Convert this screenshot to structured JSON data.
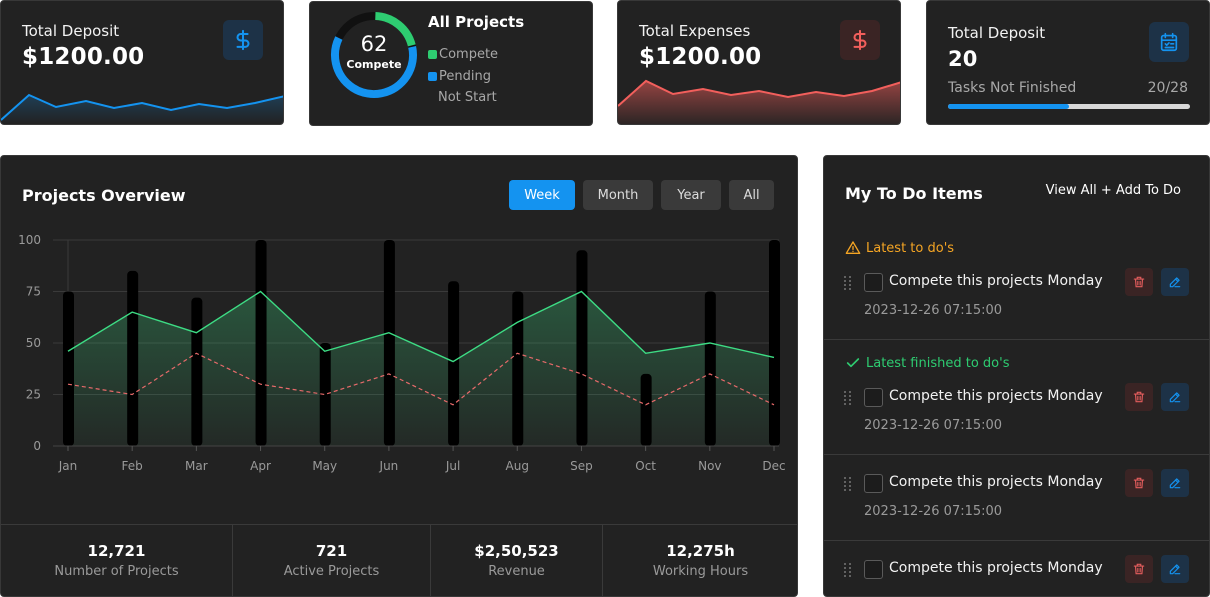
{
  "cards": {
    "deposit": {
      "title": "Total Deposit",
      "value": "$1200.00",
      "icon": "dollar-icon",
      "color": "#1493f0"
    },
    "projects": {
      "title": "All Projects",
      "count": "62",
      "count_label": "Compete",
      "legend": [
        {
          "label": "Compete",
          "color": "#2ecc71"
        },
        {
          "label": "Pending",
          "color": "#1493f0"
        },
        {
          "label": "Not Start",
          "color": ""
        }
      ]
    },
    "expenses": {
      "title": "Total Expenses",
      "value": "$1200.00",
      "icon": "dollar-icon",
      "color": "#f25f5c"
    },
    "tasks": {
      "title": "Total Deposit",
      "value": "20",
      "label": "Tasks Not Finished",
      "ratio": "20/28",
      "progress": 0.5,
      "icon": "calendar-check-icon"
    }
  },
  "overview": {
    "title": "Projects Overview",
    "filters": [
      {
        "label": "Week",
        "active": true
      },
      {
        "label": "Month",
        "active": false
      },
      {
        "label": "Year",
        "active": false
      },
      {
        "label": "All",
        "active": false
      }
    ],
    "stats": [
      {
        "value": "12,721",
        "label": "Number of Projects"
      },
      {
        "value": "721",
        "label": "Active Projects"
      },
      {
        "value": "$2,50,523",
        "label": "Revenue"
      },
      {
        "value": "12,275h",
        "label": "Working Hours"
      }
    ]
  },
  "chart_data": {
    "type": "bar",
    "categories": [
      "Jan",
      "Feb",
      "Mar",
      "Apr",
      "May",
      "Jun",
      "Jul",
      "Aug",
      "Sep",
      "Oct",
      "Nov",
      "Dec"
    ],
    "yticks": [
      0,
      25,
      50,
      75,
      100
    ],
    "ylim": [
      0,
      100
    ],
    "grid": true,
    "series": [
      {
        "type": "bar",
        "color": "#000000",
        "values": [
          75,
          85,
          72,
          100,
          50,
          100,
          80,
          75,
          95,
          35,
          75,
          100
        ]
      },
      {
        "type": "area",
        "color": "#3ddc84",
        "values": [
          46,
          65,
          55,
          75,
          46,
          55,
          41,
          60,
          75,
          45,
          50,
          43
        ]
      },
      {
        "type": "line",
        "dashed": true,
        "color": "#e86a6a",
        "values": [
          30,
          25,
          45,
          30,
          25,
          35,
          20,
          45,
          35,
          20,
          35,
          20
        ]
      }
    ]
  },
  "todo": {
    "title": "My To Do Items",
    "links": "View All + Add To Do",
    "sections": [
      {
        "heading": "Latest to do's",
        "color": "#f5a524",
        "icon": "warning-icon"
      },
      {
        "heading": "Latest finished to do's",
        "color": "#2ecc71",
        "icon": "check-icon"
      }
    ],
    "items": [
      {
        "text": "Compete this projects Monday",
        "time": "2023-12-26 07:15:00"
      },
      {
        "text": "Compete this projects Monday",
        "time": "2023-12-26 07:15:00"
      },
      {
        "text": "Compete this projects Monday",
        "time": "2023-12-26 07:15:00"
      },
      {
        "text": "Compete this projects Monday",
        "time": ""
      }
    ]
  }
}
